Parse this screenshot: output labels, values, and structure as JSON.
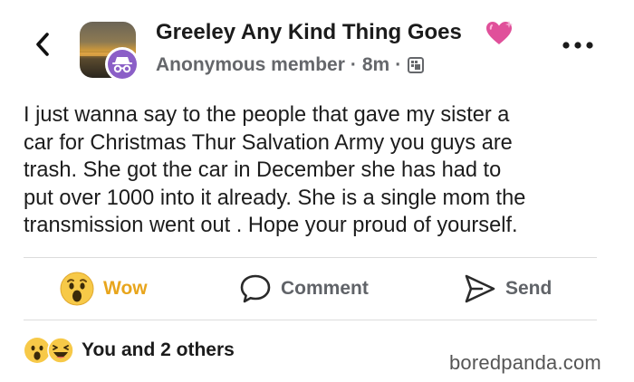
{
  "header": {
    "group_name": "Greeley Any Kind Thing Goes",
    "author": "Anonymous member",
    "separator": "·",
    "time": "8m",
    "icons": {
      "back": "chevron-left-icon",
      "emoji": "sparkling-heart-icon",
      "audience": "group-audience-icon",
      "more": "more-options-icon"
    }
  },
  "post": {
    "text": "I just wanna say to the people that gave my sister a\ncar for Christmas Thur Salvation Army you guys are\ntrash. She got the car in December  she has had to\nput over 1000 into it already.  She is a single mom the\ntransmission went out . Hope your proud of yourself."
  },
  "actions": {
    "wow_label": "Wow",
    "comment_label": "Comment",
    "send_label": "Send",
    "wow_color": "#e8a51c"
  },
  "reactions": {
    "summary": "You and 2 others",
    "types": [
      "wow",
      "haha"
    ]
  },
  "watermark": "boredpanda.com"
}
